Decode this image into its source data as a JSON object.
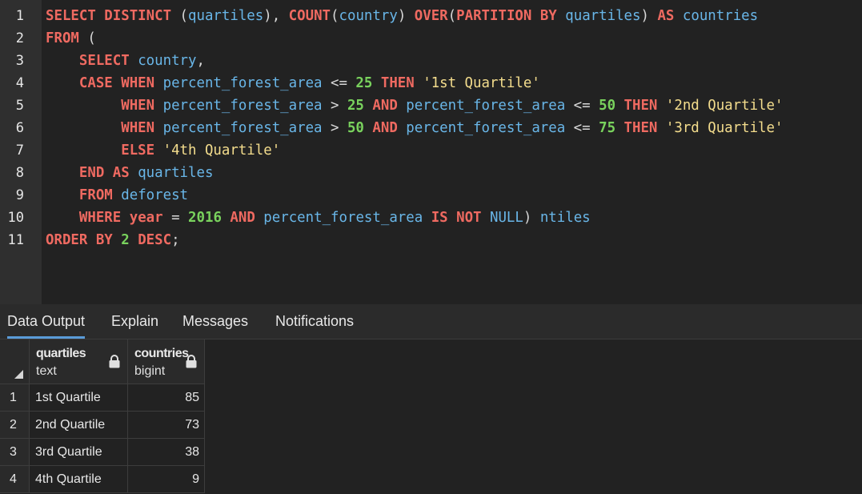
{
  "editor": {
    "line_numbers": [
      "1",
      "2",
      "3",
      "4",
      "5",
      "6",
      "7",
      "8",
      "9",
      "10",
      "11"
    ],
    "code": [
      [
        [
          "kw",
          "SELECT DISTINCT "
        ],
        [
          "op",
          "("
        ],
        [
          "id",
          "quartiles"
        ],
        [
          "op",
          "), "
        ],
        [
          "kw",
          "COUNT"
        ],
        [
          "op",
          "("
        ],
        [
          "id",
          "country"
        ],
        [
          "op",
          ") "
        ],
        [
          "kw",
          "OVER"
        ],
        [
          "op",
          "("
        ],
        [
          "kw",
          "PARTITION BY "
        ],
        [
          "id",
          "quartiles"
        ],
        [
          "op",
          ") "
        ],
        [
          "kw",
          "AS "
        ],
        [
          "id",
          "countries"
        ]
      ],
      [
        [
          "kw",
          "FROM "
        ],
        [
          "op",
          "("
        ]
      ],
      [
        [
          "op",
          "    "
        ],
        [
          "kw",
          "SELECT "
        ],
        [
          "id",
          "country"
        ],
        [
          "op",
          ","
        ]
      ],
      [
        [
          "op",
          "    "
        ],
        [
          "kw",
          "CASE WHEN "
        ],
        [
          "id",
          "percent_forest_area "
        ],
        [
          "op",
          "<= "
        ],
        [
          "num",
          "25 "
        ],
        [
          "kw",
          "THEN "
        ],
        [
          "str",
          "'1st Quartile'"
        ]
      ],
      [
        [
          "op",
          "         "
        ],
        [
          "kw",
          "WHEN "
        ],
        [
          "id",
          "percent_forest_area "
        ],
        [
          "op",
          "> "
        ],
        [
          "num",
          "25 "
        ],
        [
          "kw",
          "AND "
        ],
        [
          "id",
          "percent_forest_area "
        ],
        [
          "op",
          "<= "
        ],
        [
          "num",
          "50 "
        ],
        [
          "kw",
          "THEN "
        ],
        [
          "str",
          "'2nd Quartile'"
        ]
      ],
      [
        [
          "op",
          "         "
        ],
        [
          "kw",
          "WHEN "
        ],
        [
          "id",
          "percent_forest_area "
        ],
        [
          "op",
          "> "
        ],
        [
          "num",
          "50 "
        ],
        [
          "kw",
          "AND "
        ],
        [
          "id",
          "percent_forest_area "
        ],
        [
          "op",
          "<= "
        ],
        [
          "num",
          "75 "
        ],
        [
          "kw",
          "THEN "
        ],
        [
          "str",
          "'3rd Quartile'"
        ]
      ],
      [
        [
          "op",
          "         "
        ],
        [
          "kw",
          "ELSE "
        ],
        [
          "str",
          "'4th Quartile'"
        ]
      ],
      [
        [
          "op",
          "    "
        ],
        [
          "kw",
          "END AS "
        ],
        [
          "id",
          "quartiles"
        ]
      ],
      [
        [
          "op",
          "    "
        ],
        [
          "kw",
          "FROM "
        ],
        [
          "id",
          "deforest"
        ]
      ],
      [
        [
          "op",
          "    "
        ],
        [
          "kw",
          "WHERE "
        ],
        [
          "kw",
          "year "
        ],
        [
          "op",
          "= "
        ],
        [
          "num",
          "2016 "
        ],
        [
          "kw",
          "AND "
        ],
        [
          "id",
          "percent_forest_area "
        ],
        [
          "kw",
          "IS NOT "
        ],
        [
          "lit",
          "NULL"
        ],
        [
          "op",
          ") "
        ],
        [
          "id",
          "ntiles"
        ]
      ],
      [
        [
          "kw",
          "ORDER BY "
        ],
        [
          "num",
          "2 "
        ],
        [
          "kw",
          "DESC"
        ],
        [
          "op",
          ";"
        ]
      ]
    ]
  },
  "tabs": [
    {
      "label": "Data Output",
      "active": true
    },
    {
      "label": "Explain",
      "active": false
    },
    {
      "label": "Messages",
      "active": false
    },
    {
      "label": "Notifications",
      "active": false
    }
  ],
  "grid": {
    "columns": [
      {
        "name": "quartiles",
        "type": "text"
      },
      {
        "name": "countries",
        "type": "bigint"
      }
    ],
    "rows": [
      {
        "num": "1",
        "quartiles": "1st Quartile",
        "countries": "85"
      },
      {
        "num": "2",
        "quartiles": "2nd Quartile",
        "countries": "73"
      },
      {
        "num": "3",
        "quartiles": "3rd Quartile",
        "countries": "38"
      },
      {
        "num": "4",
        "quartiles": "4th Quartile",
        "countries": "9"
      }
    ]
  }
}
